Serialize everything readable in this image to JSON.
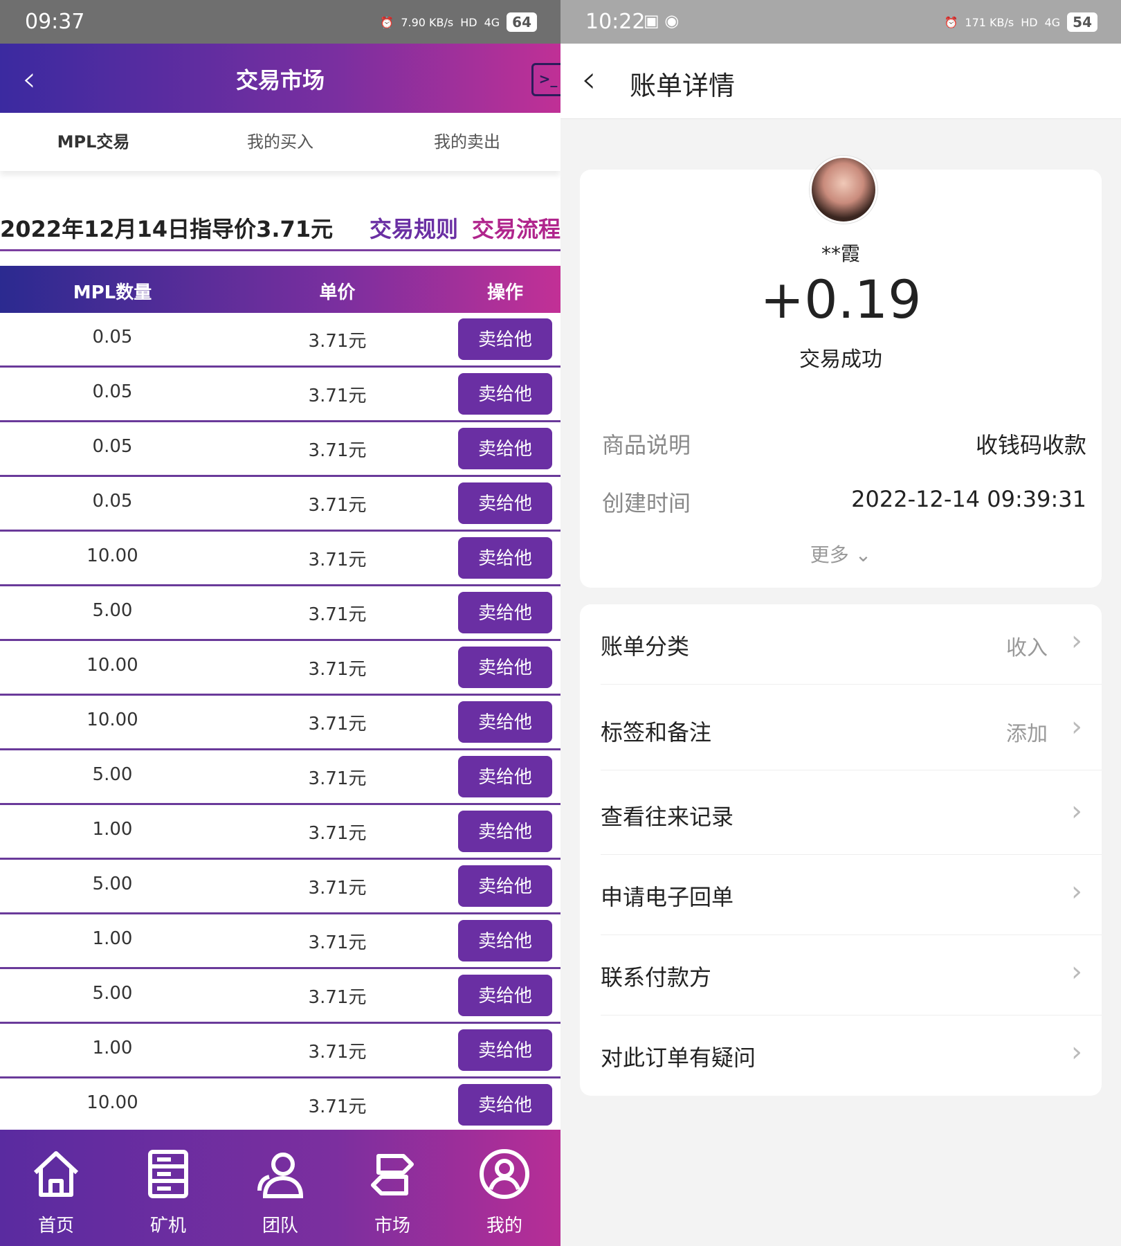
{
  "left": {
    "status_time": "09:37",
    "status_speed": "7.90 KB/s",
    "status_battery": "64",
    "status_hd": "HD",
    "status_net": "4G",
    "title": "交易市场",
    "tabs": [
      "MPL交易",
      "我的买入",
      "我的卖出"
    ],
    "guide_text": "2022年12月14日指导价3.71元",
    "rule_link": "交易规则",
    "flow_link": "交易流程",
    "table_headers": [
      "MPL数量",
      "单价",
      "操作"
    ],
    "rows": [
      {
        "qty": "0.05",
        "price": "3.71元",
        "action": "卖给他"
      },
      {
        "qty": "0.05",
        "price": "3.71元",
        "action": "卖给他"
      },
      {
        "qty": "0.05",
        "price": "3.71元",
        "action": "卖给他"
      },
      {
        "qty": "0.05",
        "price": "3.71元",
        "action": "卖给他"
      },
      {
        "qty": "10.00",
        "price": "3.71元",
        "action": "卖给他"
      },
      {
        "qty": "5.00",
        "price": "3.71元",
        "action": "卖给他"
      },
      {
        "qty": "10.00",
        "price": "3.71元",
        "action": "卖给他"
      },
      {
        "qty": "10.00",
        "price": "3.71元",
        "action": "卖给他"
      },
      {
        "qty": "5.00",
        "price": "3.71元",
        "action": "卖给他"
      },
      {
        "qty": "1.00",
        "price": "3.71元",
        "action": "卖给他"
      },
      {
        "qty": "5.00",
        "price": "3.71元",
        "action": "卖给他"
      },
      {
        "qty": "1.00",
        "price": "3.71元",
        "action": "卖给他"
      },
      {
        "qty": "5.00",
        "price": "3.71元",
        "action": "卖给他"
      },
      {
        "qty": "1.00",
        "price": "3.71元",
        "action": "卖给他"
      },
      {
        "qty": "10.00",
        "price": "3.71元",
        "action": "卖给他"
      }
    ],
    "nav": [
      {
        "label": "首页",
        "icon": "home-icon"
      },
      {
        "label": "矿机",
        "icon": "server-icon"
      },
      {
        "label": "团队",
        "icon": "team-icon"
      },
      {
        "label": "市场",
        "icon": "exchange-icon"
      },
      {
        "label": "我的",
        "icon": "user-icon"
      }
    ]
  },
  "right": {
    "status_time": "10:22",
    "status_speed": "171 KB/s",
    "status_battery": "54",
    "status_hd": "HD",
    "status_net": "4G",
    "title": "账单详情",
    "name": "**霞",
    "amount": "+0.19",
    "state": "交易成功",
    "details": [
      {
        "k": "商品说明",
        "v": "收钱码收款"
      },
      {
        "k": "创建时间",
        "v": "2022-12-14 09:39:31"
      }
    ],
    "more": "更多",
    "items": [
      {
        "label": "账单分类",
        "value": "收入"
      },
      {
        "label": "标签和备注",
        "value": "添加"
      },
      {
        "label": "查看往来记录",
        "value": ""
      },
      {
        "label": "申请电子回单",
        "value": ""
      },
      {
        "label": "联系付款方",
        "value": ""
      },
      {
        "label": "对此订单有疑问",
        "value": ""
      }
    ]
  }
}
